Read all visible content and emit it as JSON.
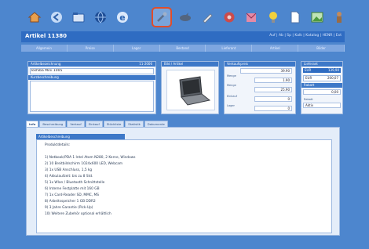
{
  "title": "Artikel 11380",
  "nav_links": "Auf | Ab | Sp | Kalk | Katalog | HENR | Ext",
  "toolbar": {
    "buttons": [
      {
        "name": "home-icon",
        "color": "#c96b3a"
      },
      {
        "name": "back-icon",
        "color": "#6a9ad8"
      },
      {
        "name": "folder-icon",
        "color": "#3b6fb8"
      },
      {
        "name": "globe-icon",
        "color": "#1f4e96"
      },
      {
        "name": "browser-e-icon",
        "color": "#2a63b0"
      },
      {
        "name": "tools-icon",
        "color": "#7a8aa6",
        "active": true
      },
      {
        "name": "dolphin-icon",
        "color": "#53657f"
      },
      {
        "name": "pen-icon",
        "color": "#d9d9d9"
      },
      {
        "name": "settings-icon",
        "color": "#cc4b4b"
      },
      {
        "name": "mail-icon",
        "color": "#d95a7a"
      },
      {
        "name": "bulb-icon",
        "color": "#f2d03b"
      },
      {
        "name": "document-icon",
        "color": "#f4f4f4"
      },
      {
        "name": "image-icon",
        "color": "#69b25b"
      },
      {
        "name": "person-icon",
        "color": "#9a6b43"
      }
    ]
  },
  "top_tabs": [
    "Allgemein",
    "Preise",
    "Lager",
    "Bestand",
    "Lieferant",
    "Artikel",
    "Bilder"
  ],
  "left_panel": {
    "header": "Artikelbezeichnung",
    "header_right": "11-2006",
    "name_value": "Toshiba Mini 1005",
    "sub_header": "Kurzbeschreibung"
  },
  "image_panel": {
    "header": "Bild / Artikel"
  },
  "prices_panel": {
    "header": "Verkaufspreis",
    "value_top": "39.90",
    "rows": [
      {
        "label": "Menge",
        "value": "1.90"
      },
      {
        "label": "Menge",
        "value": "25.90"
      },
      {
        "label": "Einkauf",
        "value": "0"
      },
      {
        "label": "Lager",
        "value": "0"
      }
    ]
  },
  "right_panel": {
    "header": "Lieferant",
    "sel_label": "EUR",
    "sel_value": "139,90",
    "row2_label": "EUR",
    "row2_value": "200,07",
    "sub_header": "Rabatt",
    "row3_value": "0,00",
    "row4_label": "Rabatt",
    "row4_value": "Aktiv"
  },
  "detail_tabs": [
    "Info",
    "Beschreibung",
    "Verkauf",
    "Einkauf",
    "Stückliste",
    "Statistik",
    "Dokumente"
  ],
  "description": {
    "header": "Artikelbeschreibung",
    "lines": [
      "Produktdetails:",
      "",
      "1) Netbook/PDA 1 Intel Atom N280, 2 Kerne, Windows",
      "2) 10 Breitbildschirm 1024x600 LED, Webcam",
      "3) 1x USB Anschluss, 1,5 kg",
      "4) Akkulaufzeit: bis zu 8 Std.",
      "5) 1x Wlan / Bluetooth Schnittstelle",
      "6) Interne Festplatte mit 160 GB",
      "7) 1x Card-Reader SD, MMC, MS",
      "8) Arbeitsspeicher 1 GB DDR2",
      "9) 3 Jahre Garantie (Pick-Up)",
      "10) Weitere Zubehör optional erhältlich"
    ]
  }
}
